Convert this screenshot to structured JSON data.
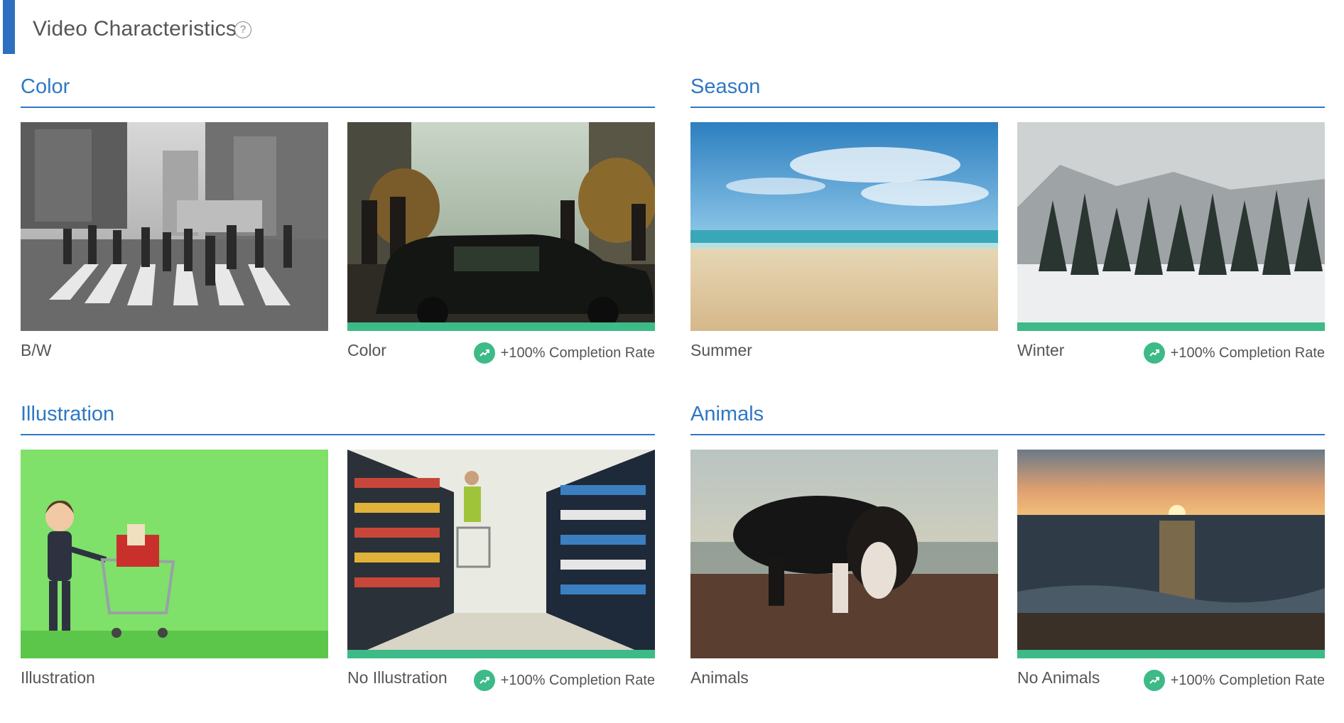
{
  "header": {
    "title": "Video Characteristics",
    "help_glyph": "?",
    "help_icon": "question-circle-icon",
    "accent_color": "#2e6fbf"
  },
  "colors": {
    "section_title": "#2f78c4",
    "winner_bar": "#3dba87",
    "text": "#555555"
  },
  "sections": [
    {
      "title": "Color",
      "left": {
        "label": "B/W",
        "image": "bw-city-crosswalk"
      },
      "right": {
        "label": "Color",
        "image": "color-street-car",
        "winner": true,
        "rate": "+100% Completion Rate"
      }
    },
    {
      "title": "Season",
      "left": {
        "label": "Summer",
        "image": "beach-blue-sky"
      },
      "right": {
        "label": "Winter",
        "image": "snowy-pine-forest",
        "winner": true,
        "rate": "+100% Completion Rate"
      }
    },
    {
      "title": "Illustration",
      "left": {
        "label": "Illustration",
        "image": "cartoon-woman-shopping-cart"
      },
      "right": {
        "label": "No Illustration",
        "image": "supermarket-aisle",
        "winner": true,
        "rate": "+100% Completion Rate"
      }
    },
    {
      "title": "Animals",
      "left": {
        "label": "Animals",
        "image": "puppy-on-beach"
      },
      "right": {
        "label": "No Animals",
        "image": "ocean-sunset",
        "winner": true,
        "rate": "+100% Completion Rate"
      }
    }
  ],
  "icons": {
    "trend": "trending-up-icon"
  }
}
